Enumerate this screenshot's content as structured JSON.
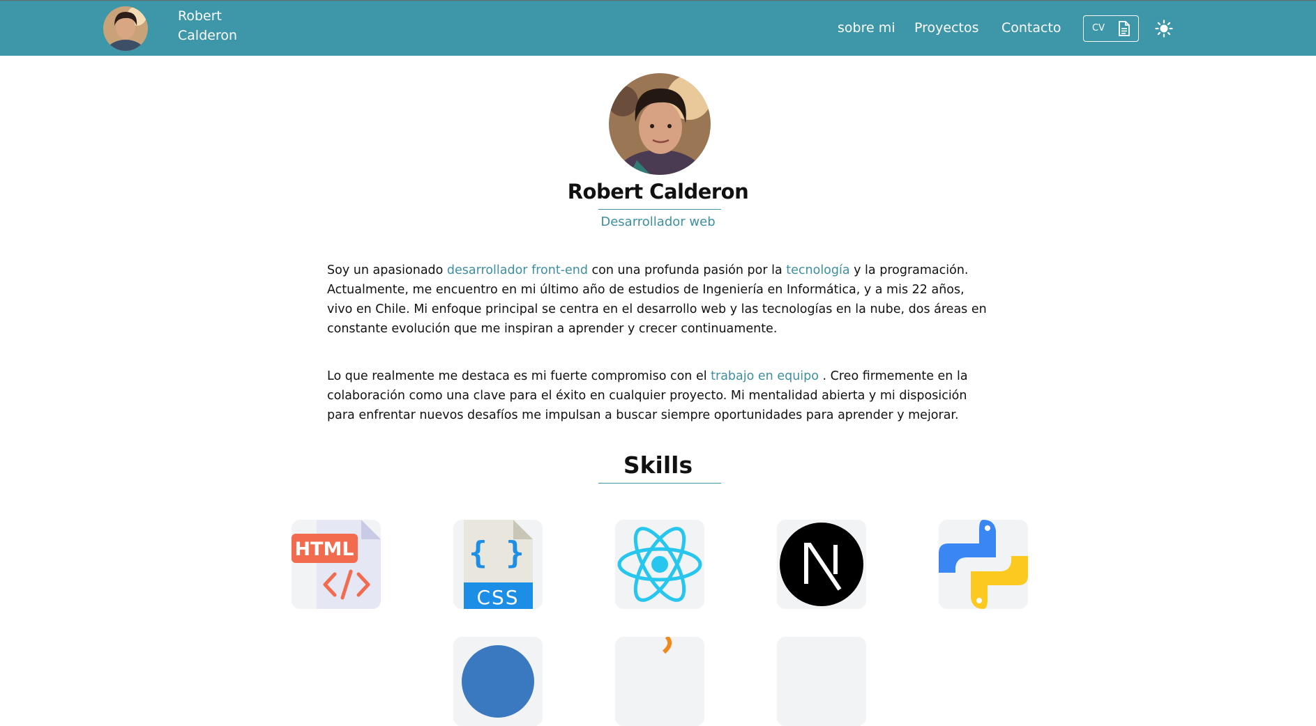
{
  "nav": {
    "name": "Robert Calderon",
    "links": [
      "sobre mi",
      "Proyectos",
      "Contacto"
    ],
    "cv_label": "CV",
    "icons": [
      "avatar",
      "document-icon",
      "sun-icon"
    ]
  },
  "profile": {
    "name": "Robert Calderon",
    "role": "Desarrollador web"
  },
  "about": {
    "p1_a": "Soy un apasionado ",
    "p1_hl1": "desarrollador front-end",
    "p1_b": " con una profunda pasión por la ",
    "p1_hl2": "tecnología",
    "p1_c": " y la programación. Actualmente, me encuentro en mi último año de estudios de Ingeniería en Informática, y a mis 22 años, vivo en Chile. Mi enfoque principal se centra en el desarrollo web y las tecnologías en la nube, dos áreas en constante evolución que me inspiran a aprender y crecer continuamente.",
    "p2_a": "Lo que realmente me destaca es mi fuerte compromiso con el ",
    "p2_hl": "trabajo en equipo",
    "p2_b": " . Creo firmemente en la colaboración como una clave para el éxito en cualquier proyecto. Mi mentalidad abierta y mi disposición para enfrentar nuevos desafíos me impulsan a buscar siempre oportunidades para aprender y mejorar."
  },
  "skills": {
    "title": "Skills",
    "icons": [
      "html-icon",
      "css-icon",
      "react-icon",
      "nextjs-icon",
      "python-icon"
    ],
    "html_text": "HTML",
    "css_text": "CSS"
  },
  "colors": {
    "nav_bg": "#3d97a8",
    "accent": "#3d8fa0"
  }
}
